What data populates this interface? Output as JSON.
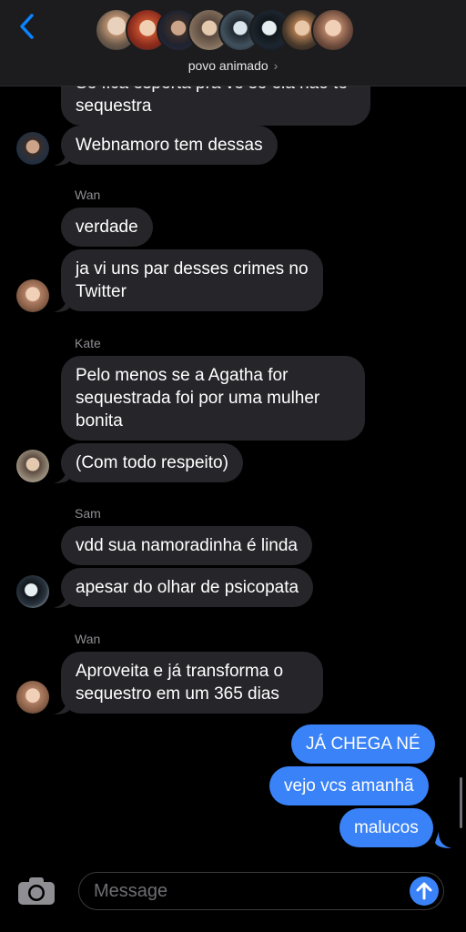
{
  "header": {
    "group_name": "povo animado",
    "back_icon": "chevron-left-icon",
    "info_chevron": "›",
    "accent": "#0a84ff"
  },
  "messages": [
    {
      "sender": null,
      "text": "Se ficá esperta pra ve se ela não te sequestra",
      "dir": "in"
    },
    {
      "sender": null,
      "text": "Webnamoro tem dessas",
      "dir": "in"
    },
    {
      "sender": "Wan",
      "text": "verdade",
      "dir": "in"
    },
    {
      "sender": "Wan",
      "text": "ja vi uns par desses crimes no Twitter",
      "dir": "in"
    },
    {
      "sender": "Kate",
      "text": "Pelo menos se a Agatha for sequestrada foi por uma mulher bonita",
      "dir": "in"
    },
    {
      "sender": "Kate",
      "text": "(Com todo respeito)",
      "dir": "in"
    },
    {
      "sender": "Sam",
      "text": "vdd sua namoradinha é linda",
      "dir": "in"
    },
    {
      "sender": "Sam",
      "text": "apesar do olhar de psicopata",
      "dir": "in"
    },
    {
      "sender": "Wan",
      "text": "Aproveita e já transforma o sequestro em um 365 dias",
      "dir": "in"
    },
    {
      "sender": "me",
      "text": "JÁ CHEGA NÉ",
      "dir": "out"
    },
    {
      "sender": "me",
      "text": "vejo vcs amanhã",
      "dir": "out"
    },
    {
      "sender": "me",
      "text": "malucos",
      "dir": "out"
    }
  ],
  "sender_labels": {
    "wan1": "Wan",
    "kate": "Kate",
    "sam": "Sam",
    "wan2": "Wan"
  },
  "composer": {
    "placeholder": "Message",
    "camera_icon": "camera-icon",
    "send_icon": "send-arrow-icon"
  },
  "colors": {
    "incoming_bubble": "#26252a",
    "outgoing_bubble": "#3a82f7",
    "background": "#000000"
  }
}
